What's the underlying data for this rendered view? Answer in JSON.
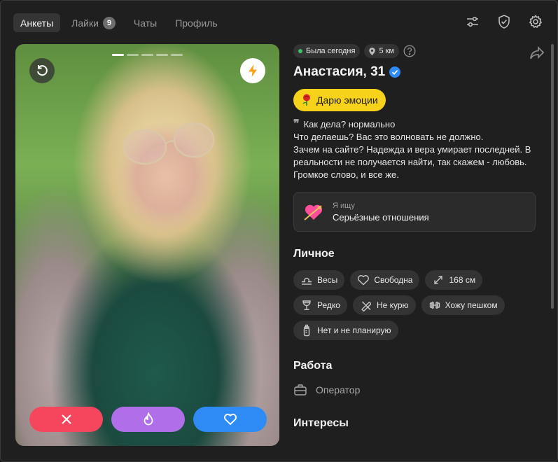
{
  "nav": {
    "tabs": [
      {
        "label": "Анкеты"
      },
      {
        "label": "Лайки",
        "badge": "9"
      },
      {
        "label": "Чаты"
      },
      {
        "label": "Профиль"
      }
    ],
    "icons": [
      "filter-sliders-icon",
      "shield-check-icon",
      "gear-icon"
    ]
  },
  "photo": {
    "slides_total": 5,
    "slide_active": 1,
    "buttons": [
      "rewind-icon",
      "lightning-icon",
      "close-icon",
      "fire-icon",
      "heart-icon"
    ],
    "colors": {
      "dislike": "#f6465d",
      "superlike": "#b06ee8",
      "like": "#2e8bf5",
      "boost": "#f7a21a"
    }
  },
  "profile": {
    "status": "Была сегодня",
    "distance": "5 км",
    "name": "Анастасия, 31",
    "gift_label": "Дарю эмоции",
    "about_lines": [
      "Как дела? нормально",
      "Что делаешь? Вас это волновать не должно.",
      "Зачем на сайте? Надежда и вера умирает последней. В реальности не получается найти, так скажем - любовь. Громкое слово, и все же."
    ],
    "seeking_label": "Я ищу",
    "seeking_value": "Серьёзные отношения"
  },
  "personal": {
    "title": "Личное",
    "tags": [
      {
        "icon": "libra-icon",
        "label": "Весы"
      },
      {
        "icon": "heart-outline-icon",
        "label": "Свободна"
      },
      {
        "icon": "height-arrows-icon",
        "label": "168 см"
      },
      {
        "icon": "wine-glass-icon",
        "label": "Редко"
      },
      {
        "icon": "no-smoking-icon",
        "label": "Не курю"
      },
      {
        "icon": "dumbbell-icon",
        "label": "Хожу пешком"
      },
      {
        "icon": "baby-bottle-icon",
        "label": "Нет и не планирую"
      }
    ]
  },
  "work": {
    "title": "Работа",
    "value": "Оператор"
  },
  "interests": {
    "title": "Интересы"
  }
}
